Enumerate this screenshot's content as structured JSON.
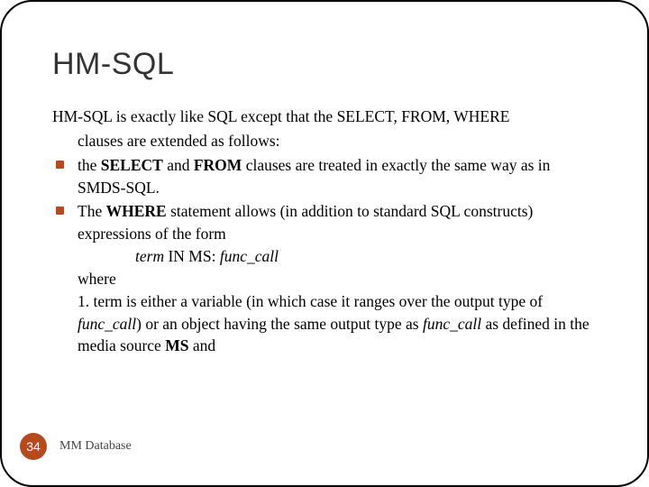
{
  "title": "HM-SQL",
  "intro_l1": "HM-SQL is exactly like SQL except that the SELECT, FROM, WHERE",
  "intro_l2": "clauses are extended as follows:",
  "b1_a": "the ",
  "b1_b": "SELECT",
  "b1_c": " and ",
  "b1_d": "FROM",
  "b1_e": " clauses are treated in exactly the same way as in SMDS-SQL.",
  "b2_a": "The ",
  "b2_b": "WHERE",
  "b2_c": " statement allows (in addition to standard SQL constructs) expressions of the form",
  "expr_a": "term",
  "expr_b": " IN ",
  "expr_c": "MS",
  "expr_d": ": ",
  "expr_e": "func_call",
  "where_lbl": "where",
  "def_a": "1. term is either a variable (in which case it ranges over the output type of ",
  "def_b": "func_call",
  "def_c": ") or an object having the same output type as ",
  "def_d": "func_call",
  "def_e": " as defined in the media source ",
  "def_f": "MS",
  "def_g": " and",
  "page": "34",
  "footer": "MM Database"
}
